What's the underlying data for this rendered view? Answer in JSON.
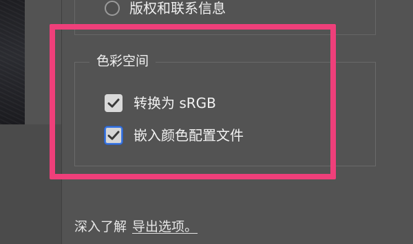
{
  "metadata_option": {
    "label": "版权和联系信息",
    "selected": false
  },
  "color_space": {
    "title": "色彩空间",
    "convert_srgb": {
      "label": "转换为 sRGB",
      "checked": true
    },
    "embed_profile": {
      "label": "嵌入颜色配置文件",
      "checked": true
    }
  },
  "footer": {
    "prefix": "深入了解",
    "link_label": "导出选项。"
  },
  "colors": {
    "panel_background": "#535353",
    "highlight_frame": "#ef3f7a",
    "focus_ring": "#3d78e3"
  }
}
